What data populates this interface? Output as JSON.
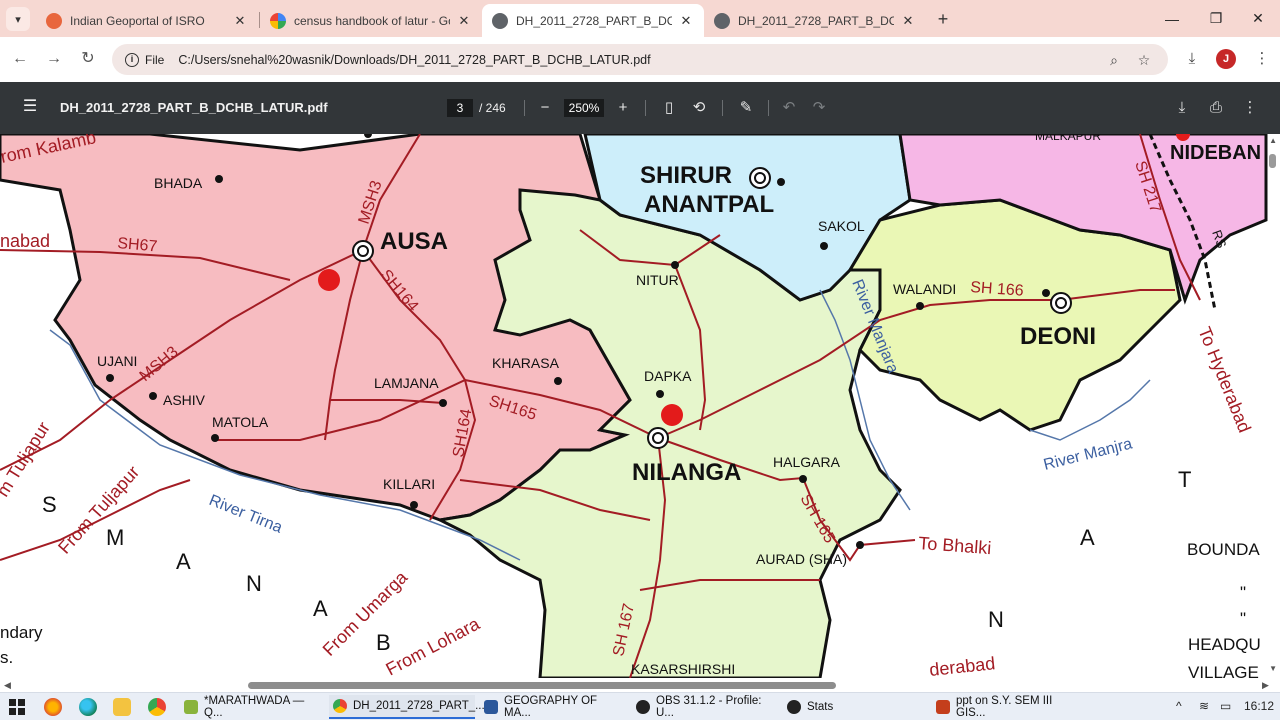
{
  "browser": {
    "tabs": [
      {
        "title": "Indian Geoportal of ISRO",
        "favicon": "isro-favicon"
      },
      {
        "title": "census handbook of latur - Goo",
        "favicon": "google-favicon"
      },
      {
        "title": "DH_2011_2728_PART_B_DCHB_L",
        "favicon": "chrome-favicon",
        "active": true
      },
      {
        "title": "DH_2011_2728_PART_B_DCHB_L",
        "favicon": "chrome-favicon"
      }
    ],
    "url_scheme_label": "File",
    "url": "C:/Users/snehal%20wasnik/Downloads/DH_2011_2728_PART_B_DCHB_LATUR.pdf",
    "profile_initial": "J"
  },
  "pdf": {
    "filename": "DH_2011_2728_PART_B_DCHB_LATUR.pdf",
    "page_current": "3",
    "page_total": "/ 246",
    "zoom": "250%"
  },
  "map": {
    "towns": {
      "ausa": "AUSA",
      "shirur1": "SHIRUR",
      "shirur2": "ANANTPAL",
      "nidebar": "NIDEBAN",
      "deoni": "DEONI",
      "nilanga": "NILANGA"
    },
    "villages": {
      "bhada": "BHADA",
      "sakol": "SAKOL",
      "nitur": "NITUR",
      "walandi": "WALANDI",
      "ujani": "UJANI",
      "ashiv": "ASHIV",
      "kharasa": "KHARASA",
      "lamjana": "LAMJANA",
      "dapka": "DAPKA",
      "matola": "MATOLA",
      "halgara": "HALGARA",
      "killari": "KILLARI",
      "aurad": "AURAD (SHA)",
      "kasarshirshi": "KASARSHIRSHI",
      "malkapur": "MALKAPUR"
    },
    "roads": {
      "msh3a": "MSH3",
      "msh3b": "MSH3",
      "sh67": "SH67",
      "sh164a": "SH164",
      "sh164b": "SH164",
      "sh165a": "SH165",
      "sh165b": "SH 165",
      "sh166": "SH 166",
      "sh167": "SH 167",
      "sh217": "SH 217",
      "rs": "RS"
    },
    "directions": {
      "kalamb": "rom Kalamb",
      "abad": "nabad",
      "tuljapur1": "m Tuljapur",
      "tuljapur2": "From Tuljapur",
      "umarga": "From Umarga",
      "lohara": "From Lohara",
      "bhalki": "To Bhalki",
      "hyderabad": "To Hyderabad",
      "derabad": "derabad"
    },
    "rivers": {
      "tirna": "River Tirna",
      "manjara": "River Manjara",
      "manjra": "River Manjra"
    },
    "region_letters": {
      "os_s": "S",
      "os_m": "M",
      "os_a": "A",
      "os_n": "N",
      "os_a2": "A",
      "os_b": "B",
      "ka_t": "T",
      "ka_a": "A",
      "ka_n": "N"
    },
    "legend": {
      "boundary": "BOUNDA",
      "quote1": "\"",
      "quote2": "\"",
      "headquarters": "HEADQU",
      "village": "VILLAGE",
      "left_line1": "ndary",
      "left_line2": "s."
    }
  },
  "taskbar": {
    "apps": [
      {
        "label": "*MARATHWADA — Q..."
      },
      {
        "label": "DH_2011_2728_PART_..."
      },
      {
        "label": "GEOGRAPHY OF MA..."
      },
      {
        "label": "OBS 31.1.2 - Profile: U..."
      },
      {
        "label": "Stats"
      },
      {
        "label": "ppt on S.Y. SEM III GIS..."
      }
    ],
    "clock": "16:12"
  }
}
